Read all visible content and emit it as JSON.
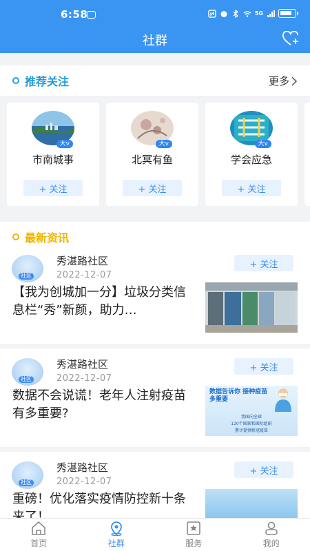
{
  "status": {
    "time": "6:58",
    "network": "5G"
  },
  "header": {
    "title": "社群"
  },
  "recommend": {
    "title": "推荐关注",
    "more": "更多",
    "dot_color": "#1aa3e8",
    "cards": [
      {
        "name": "市南城事",
        "badge": "大v",
        "follow": "+ 关注"
      },
      {
        "name": "北冥有鱼",
        "badge": "大v",
        "follow": "+ 关注"
      },
      {
        "name": "学会应急",
        "badge": "大v",
        "follow": "+ 关注"
      }
    ]
  },
  "news": {
    "title": "最新资讯",
    "dot_color": "#f0b400",
    "items": [
      {
        "source": "秀湛路社区",
        "date": "2022-12-07",
        "follow": "+ 关注",
        "avatar_tag": "社区",
        "title": "【我为创城加一分】垃圾分类信息栏“秀”新颜，助力…"
      },
      {
        "source": "秀湛路社区",
        "date": "2022-12-07",
        "follow": "+ 关注",
        "avatar_tag": "社区",
        "title": "数据不会说谎！老年人注射疫苗有多重要?",
        "thumb_text": {
          "headline": "数据告诉你 接种疫苗多重要",
          "line1": "我国向全球",
          "line2": "120个国家和国际组织",
          "line3": "累计提供新冠疫苗"
        }
      },
      {
        "source": "秀湛路社区",
        "date": "2022-12-07",
        "follow": "+ 关注",
        "avatar_tag": "社区",
        "title": "重磅！优化落实疫情防控新十条来了！"
      }
    ]
  },
  "tabs": [
    {
      "label": "首页",
      "icon": "home-icon",
      "active": false
    },
    {
      "label": "社群",
      "icon": "community-icon",
      "active": true
    },
    {
      "label": "服务",
      "icon": "service-icon",
      "active": false
    },
    {
      "label": "我的",
      "icon": "profile-icon",
      "active": false
    }
  ],
  "colors": {
    "primary": "#3a95f2",
    "accent_blue": "#3a8ef0",
    "follow_bg": "#e8f2fe"
  }
}
